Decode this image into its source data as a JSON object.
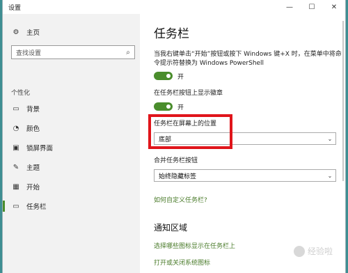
{
  "window": {
    "title": "设置",
    "buttons": {
      "minimize": "—",
      "maximize": "☐",
      "close": "✕"
    }
  },
  "sidebar": {
    "home": {
      "label": "主页",
      "icon": "gear-icon"
    },
    "search": {
      "placeholder": "查找设置",
      "icon": "search-icon"
    },
    "section_label": "个性化",
    "items": [
      {
        "label": "背景",
        "icon": "picture-icon"
      },
      {
        "label": "颜色",
        "icon": "palette-icon"
      },
      {
        "label": "锁屏界面",
        "icon": "monitor-icon"
      },
      {
        "label": "主题",
        "icon": "brush-icon"
      },
      {
        "label": "开始",
        "icon": "grid-icon"
      },
      {
        "label": "任务栏",
        "icon": "taskbar-icon",
        "active": true
      }
    ]
  },
  "main": {
    "title": "任务栏",
    "powershell_setting": {
      "description": "当我右键单击“开始”按钮或按下 Windows 键+X 时，在菜单中将命令提示符替换为 Windows PowerShell",
      "state": "开"
    },
    "badges_setting": {
      "description": "在任务栏按钮上显示徽章",
      "state": "开"
    },
    "position_setting": {
      "label": "任务栏在屏幕上的位置",
      "value": "底部"
    },
    "combine_setting": {
      "label": "合并任务栏按钮",
      "value": "始终隐藏标签"
    },
    "customize_link": "如何自定义任务栏?",
    "notification_area": {
      "title": "通知区域",
      "link1": "选择哪些图标显示在任务栏上",
      "link2": "打开或关闭系统图标"
    }
  },
  "watermark": "经验啦",
  "colors": {
    "accent": "#4a8d2c",
    "highlight": "#e0151b",
    "link": "#4a7b2a"
  }
}
